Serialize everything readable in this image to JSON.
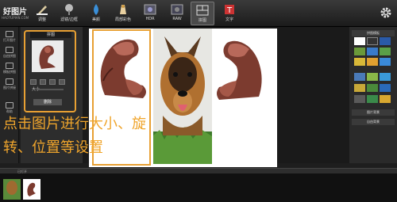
{
  "app": {
    "logo": "好图片",
    "logo_sub": "HAOTUPIAN.COM"
  },
  "toolbar": {
    "items": [
      {
        "label": "调整",
        "icon": "pencil-icon"
      },
      {
        "label": "滤镜/边框",
        "icon": "brush-icon"
      },
      {
        "label": "美颜",
        "icon": "drop-icon"
      },
      {
        "label": "局部彩色",
        "icon": "spray-icon"
      },
      {
        "label": "HDR",
        "icon": "hdr-icon"
      },
      {
        "label": "RAW",
        "icon": "raw-icon"
      },
      {
        "label": "拼图",
        "icon": "collage-icon"
      },
      {
        "label": "文字",
        "icon": "text-icon"
      }
    ],
    "active": "拼图"
  },
  "leftbar": {
    "items": [
      "打开图片",
      "自由拼图",
      "模板拼图",
      "图片拼接",
      "帮助"
    ]
  },
  "left_panel": {
    "title": "拼图",
    "size_label": "大小",
    "delete_label": "删除"
  },
  "hint": {
    "line1": "点击图片进行大小、旋",
    "line2": "转、位置等设置"
  },
  "right_panel": {
    "headers": [
      "拼图模板",
      "图片背景",
      "自由背景"
    ]
  },
  "bottom": {
    "label": "已打开"
  },
  "colors": {
    "accent": "#e8a033",
    "hint": "#f0a52c"
  }
}
